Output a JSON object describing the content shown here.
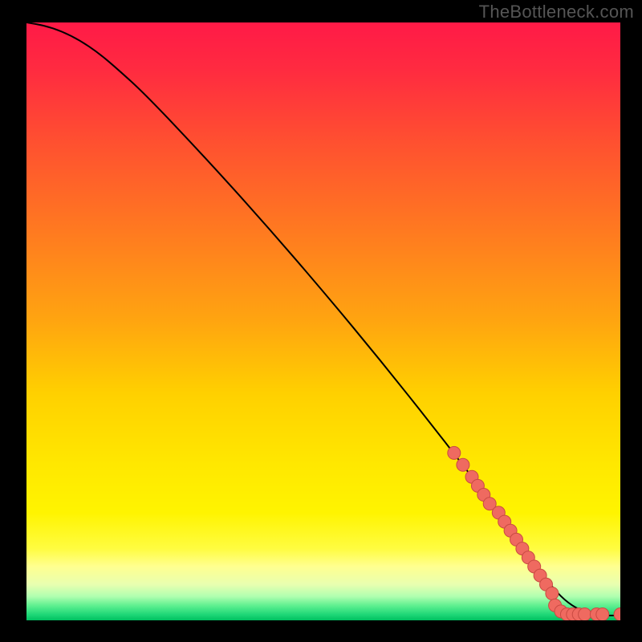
{
  "attribution": "TheBottleneck.com",
  "chart_data": {
    "type": "line",
    "title": "",
    "xlabel": "",
    "ylabel": "",
    "x_range": [
      0,
      100
    ],
    "y_range": [
      0,
      100
    ],
    "gradient_stops": [
      {
        "offset": 0.0,
        "color": "#ff1a47"
      },
      {
        "offset": 0.08,
        "color": "#ff2b40"
      },
      {
        "offset": 0.2,
        "color": "#ff5030"
      },
      {
        "offset": 0.35,
        "color": "#ff7a20"
      },
      {
        "offset": 0.5,
        "color": "#ffa510"
      },
      {
        "offset": 0.62,
        "color": "#ffd000"
      },
      {
        "offset": 0.74,
        "color": "#ffe800"
      },
      {
        "offset": 0.82,
        "color": "#fff400"
      },
      {
        "offset": 0.88,
        "color": "#fffc40"
      },
      {
        "offset": 0.91,
        "color": "#ffff90"
      },
      {
        "offset": 0.94,
        "color": "#e8ffb0"
      },
      {
        "offset": 0.96,
        "color": "#b0ffb0"
      },
      {
        "offset": 0.975,
        "color": "#60f090"
      },
      {
        "offset": 0.99,
        "color": "#20d878"
      },
      {
        "offset": 1.0,
        "color": "#00c060"
      }
    ],
    "series": [
      {
        "name": "curve",
        "type": "line",
        "x": [
          0,
          3,
          6,
          9,
          12,
          15,
          20,
          30,
          40,
          50,
          60,
          70,
          80,
          85,
          90,
          95,
          100
        ],
        "y": [
          100,
          99.5,
          98.5,
          97,
          95,
          92.5,
          88,
          77.5,
          66.5,
          55,
          43,
          30.5,
          17.5,
          10.5,
          3.5,
          0.8,
          0.8
        ]
      },
      {
        "name": "markers-diagonal",
        "type": "scatter",
        "x": [
          72,
          73.5,
          75,
          76,
          77,
          78,
          79.5,
          80.5,
          81.5,
          82.5,
          83.5,
          84.5,
          85.5,
          86.5,
          87.5,
          88.5
        ],
        "y": [
          28,
          26,
          24,
          22.5,
          21,
          19.5,
          18,
          16.5,
          15,
          13.5,
          12,
          10.5,
          9,
          7.5,
          6,
          4.5
        ]
      },
      {
        "name": "markers-flat",
        "type": "scatter",
        "x": [
          89,
          90,
          91,
          92,
          93,
          94,
          96,
          97,
          100
        ],
        "y": [
          2.5,
          1.5,
          1,
          1,
          1,
          1,
          1,
          1,
          1
        ]
      }
    ],
    "marker_style": {
      "fill": "#ef6a60",
      "stroke": "#c94a42",
      "radius": 8
    },
    "line_style": {
      "stroke": "#000000",
      "width": 2
    }
  }
}
